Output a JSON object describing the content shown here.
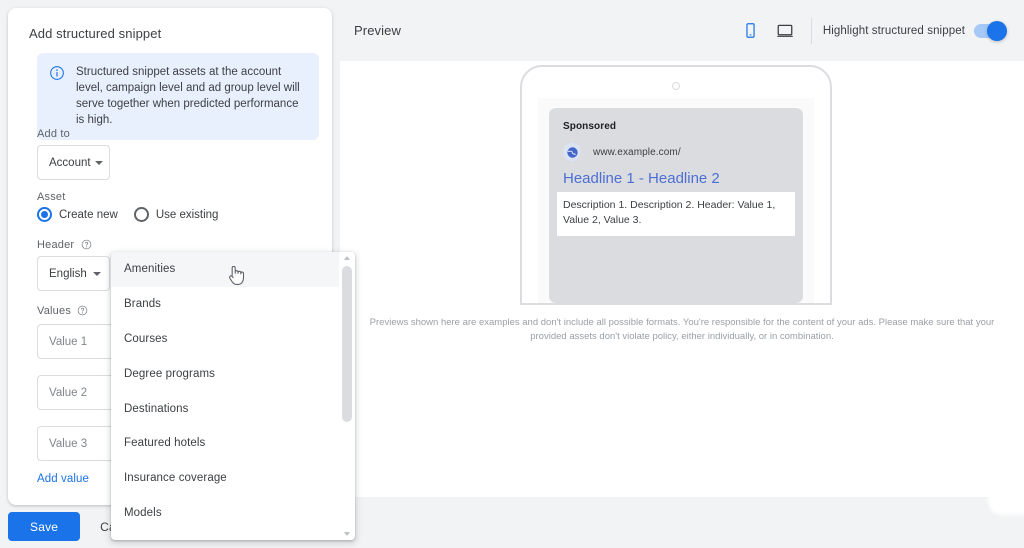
{
  "form": {
    "title": "Add structured snippet",
    "info_banner": {
      "icon": "info-icon",
      "text": "Structured snippet assets at the account level, campaign level and ad group level will serve together when predicted performance is high."
    },
    "add_to": {
      "label": "Add to",
      "selected": "Account"
    },
    "asset": {
      "label": "Asset",
      "options": [
        {
          "label": "Create new",
          "checked": true
        },
        {
          "label": "Use existing",
          "checked": false
        }
      ]
    },
    "header": {
      "label": "Header",
      "selected": "English",
      "help": "help-icon"
    },
    "values": {
      "label": "Values",
      "help": "help-icon",
      "inputs": [
        {
          "value": "",
          "placeholder": "Value 1"
        },
        {
          "value": "",
          "placeholder": "Value 2"
        },
        {
          "value": "",
          "placeholder": "Value 3"
        }
      ],
      "add_link": "Add value"
    },
    "buttons": {
      "save": "Save",
      "cancel": "Cancel"
    }
  },
  "dropdown": {
    "items": [
      "Amenities",
      "Brands",
      "Courses",
      "Degree programs",
      "Destinations",
      "Featured hotels",
      "Insurance coverage",
      "Models"
    ],
    "hovered_index": 0
  },
  "preview": {
    "title": "Preview",
    "devices": [
      {
        "icon": "mobile-icon",
        "active": true
      },
      {
        "icon": "desktop-icon",
        "active": false
      }
    ],
    "highlight_toggle": {
      "label": "Highlight structured snippet",
      "on": true
    },
    "ad": {
      "sponsored": "Sponsored",
      "favicon": "globe-icon",
      "url": "www.example.com/",
      "headline": "Headline 1 - Headline 2",
      "description": "Description 1. Description 2. Header: Value 1, Value 2, Value 3."
    },
    "disclaimer": "Previews shown here are examples and don't include all possible formats. You're responsible for the content of your ads. Please make sure that your provided assets don't violate policy, either individually, or in combination."
  },
  "colors": {
    "accent": "#1a73e8",
    "info_bg": "#e8f0fe",
    "page_bg": "#f1f3f4",
    "text_primary": "#3c4043",
    "text_secondary": "#5f6368",
    "headline_blue": "#4d6fd4",
    "ad_card_bg": "#dadce0"
  }
}
